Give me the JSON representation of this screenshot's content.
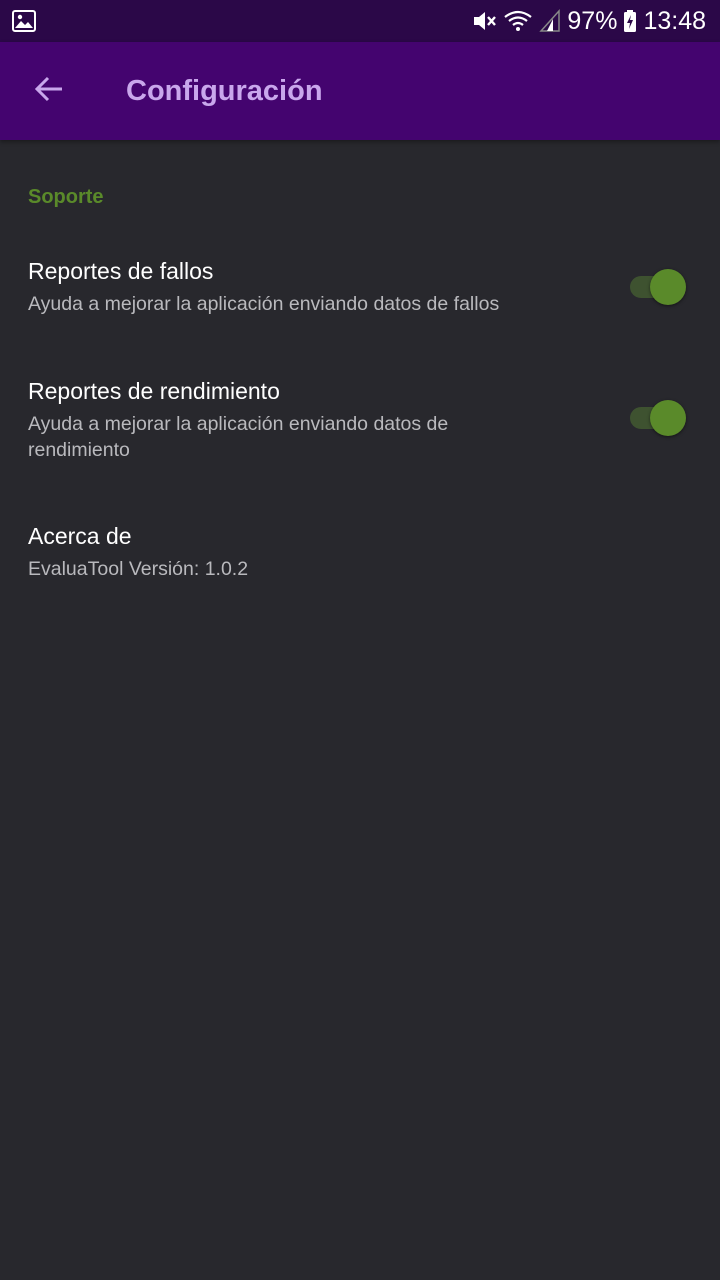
{
  "status_bar": {
    "battery": "97%",
    "time": "13:48",
    "icons": [
      "gallery-icon",
      "mute-icon",
      "wifi-icon",
      "signal-icon",
      "battery-charging-icon"
    ]
  },
  "app_bar": {
    "title": "Configuración",
    "back_icon": "arrow-back-icon"
  },
  "section": {
    "header": "Soporte"
  },
  "prefs": [
    {
      "title": "Reportes de fallos",
      "summary": "Ayuda a mejorar la aplicación enviando datos de fallos",
      "enabled": true
    },
    {
      "title": "Reportes de rendimiento",
      "summary": "Ayuda a mejorar la aplicación enviando datos de rendimiento",
      "enabled": true
    },
    {
      "title": "Acerca de",
      "summary": "EvaluaTool Versión: 1.0.2"
    }
  ],
  "colors": {
    "status_bar": "#2b0848",
    "app_bar": "#44046f",
    "title_text": "#c9a7ec",
    "background": "#28282d",
    "accent": "#5a8a2a"
  }
}
